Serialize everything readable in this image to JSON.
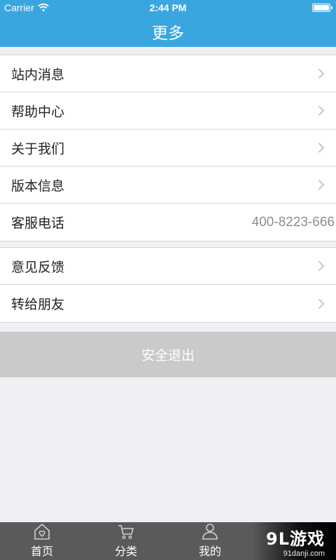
{
  "status_bar": {
    "carrier": "Carrier",
    "time": "2:44 PM"
  },
  "nav": {
    "title": "更多"
  },
  "group1": [
    {
      "label": "站内消息"
    },
    {
      "label": "帮助中心"
    },
    {
      "label": "关于我们"
    },
    {
      "label": "版本信息"
    },
    {
      "label": "客服电话",
      "value": "400-8223-666"
    }
  ],
  "group2": [
    {
      "label": "意见反馈"
    },
    {
      "label": "转给朋友"
    }
  ],
  "logout_label": "安全退出",
  "tabs": [
    {
      "label": "首页",
      "icon": "home-icon"
    },
    {
      "label": "分类",
      "icon": "cart-icon"
    },
    {
      "label": "我的",
      "icon": "user-icon"
    }
  ],
  "watermark": {
    "brand": "9L游戏",
    "domain": "91danji.com"
  },
  "colors": {
    "accent": "#3aa6e0",
    "background": "#efeff4",
    "logout": "#cacaca",
    "tabbar": "#5a5a5a"
  }
}
